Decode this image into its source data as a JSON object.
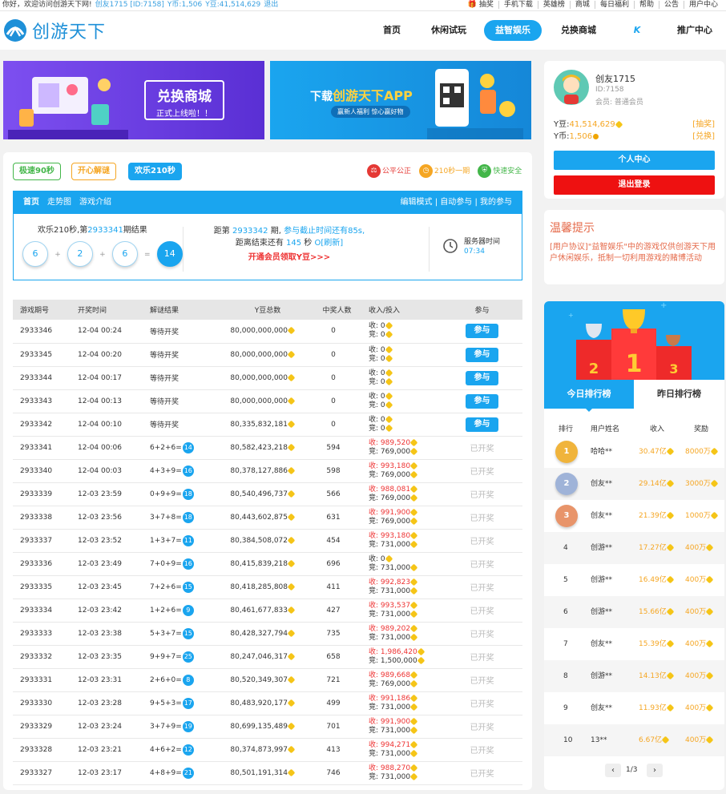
{
  "topbar": {
    "greeting": "你好，欢迎访问创游天下网!",
    "user": "创友1715 [ID:7158]",
    "ycoin": "Y币:1,506",
    "ybean": "Y豆:41,514,629",
    "logout": "退出",
    "links": [
      "抽奖",
      "手机下载",
      "英雄榜",
      "商城",
      "每日福利",
      "帮助",
      "公告",
      "用户中心"
    ]
  },
  "nav": {
    "logo": "创游天下",
    "items": [
      "首页",
      "休闲试玩",
      "益智娱乐",
      "兑换商城",
      "推广中心"
    ],
    "active_index": 2
  },
  "banners": {
    "shop_title": "兑换商城",
    "shop_sub": "正式上线啦！！",
    "app_prefix": "下载",
    "app_name": "创游天下APP",
    "app_sub": "赢新人福利 惊心赢好物"
  },
  "game_tabs": [
    "极速90秒",
    "开心解谜",
    "欢乐210秒"
  ],
  "badges": [
    {
      "icon": "⚖",
      "label": "公平公正",
      "color": "#e53935"
    },
    {
      "icon": "◷",
      "label": "210秒一期",
      "color": "#f5a623"
    },
    {
      "icon": "⛨",
      "label": "快速安全",
      "color": "#43b649"
    }
  ],
  "info": {
    "tabs": [
      "首页",
      "走势图",
      "游戏介绍"
    ],
    "links": [
      "编辑模式",
      "自动参与",
      "我的参与"
    ],
    "last_title": "欢乐210秒,第",
    "last_period": "2933341",
    "last_suffix": "期结果",
    "balls": [
      "6",
      "2",
      "6"
    ],
    "result": "14",
    "next_prefix": "距第",
    "next_period": "2933342",
    "next_mid": "期,",
    "next_deadline": "参与截止时间还有85s,",
    "end_prefix": "距离结束还有",
    "end_seconds": "145",
    "end_unit": "秒",
    "refresh": "O[刷新]",
    "vip": "开通会员领取Y豆>>>",
    "server_label": "服务器时间",
    "server_time": "07:34"
  },
  "table": {
    "headers": [
      "游戏期号",
      "开奖时间",
      "解谜结果",
      "Y豆总数",
      "中奖人数",
      "收入/投入",
      "参与"
    ],
    "rows": [
      {
        "id": "2933346",
        "time": "12-04 00:24",
        "formula": "",
        "result": "",
        "pending": "等待开奖",
        "total": "80,000,000,000",
        "winners": "0",
        "income": "收: 0",
        "stake": "竞: 0",
        "red": false,
        "open": true
      },
      {
        "id": "2933345",
        "time": "12-04 00:20",
        "formula": "",
        "result": "",
        "pending": "等待开奖",
        "total": "80,000,000,000",
        "winners": "0",
        "income": "收: 0",
        "stake": "竞: 0",
        "red": false,
        "open": true
      },
      {
        "id": "2933344",
        "time": "12-04 00:17",
        "formula": "",
        "result": "",
        "pending": "等待开奖",
        "total": "80,000,000,000",
        "winners": "0",
        "income": "收: 0",
        "stake": "竞: 0",
        "red": false,
        "open": true
      },
      {
        "id": "2933343",
        "time": "12-04 00:13",
        "formula": "",
        "result": "",
        "pending": "等待开奖",
        "total": "80,000,000,000",
        "winners": "0",
        "income": "收: 0",
        "stake": "竞: 0",
        "red": false,
        "open": true
      },
      {
        "id": "2933342",
        "time": "12-04 00:10",
        "formula": "",
        "result": "",
        "pending": "等待开奖",
        "total": "80,335,832,181",
        "winners": "0",
        "income": "收: 0",
        "stake": "竞: 0",
        "red": false,
        "open": true
      },
      {
        "id": "2933341",
        "time": "12-04 00:06",
        "formula": "6+2+6=",
        "result": "14",
        "pending": "",
        "total": "80,582,423,218",
        "winners": "594",
        "income": "收: 989,520",
        "stake": "竞: 769,000",
        "red": true,
        "open": false
      },
      {
        "id": "2933340",
        "time": "12-04 00:03",
        "formula": "4+3+9=",
        "result": "16",
        "pending": "",
        "total": "80,378,127,886",
        "winners": "598",
        "income": "收: 993,180",
        "stake": "竞: 769,000",
        "red": true,
        "open": false
      },
      {
        "id": "2933339",
        "time": "12-03 23:59",
        "formula": "0+9+9=",
        "result": "18",
        "pending": "",
        "total": "80,540,496,737",
        "winners": "566",
        "income": "收: 988,081",
        "stake": "竞: 769,000",
        "red": true,
        "open": false
      },
      {
        "id": "2933338",
        "time": "12-03 23:56",
        "formula": "3+7+8=",
        "result": "18",
        "pending": "",
        "total": "80,443,602,875",
        "winners": "631",
        "income": "收: 991,900",
        "stake": "竞: 769,000",
        "red": true,
        "open": false
      },
      {
        "id": "2933337",
        "time": "12-03 23:52",
        "formula": "1+3+7=",
        "result": "11",
        "pending": "",
        "total": "80,384,508,072",
        "winners": "454",
        "income": "收: 993,180",
        "stake": "竞: 731,000",
        "red": true,
        "open": false
      },
      {
        "id": "2933336",
        "time": "12-03 23:49",
        "formula": "7+0+9=",
        "result": "16",
        "pending": "",
        "total": "80,415,839,218",
        "winners": "696",
        "income": "收: 0",
        "stake": "竞: 731,000",
        "red": false,
        "open": false
      },
      {
        "id": "2933335",
        "time": "12-03 23:45",
        "formula": "7+2+6=",
        "result": "15",
        "pending": "",
        "total": "80,418,285,808",
        "winners": "411",
        "income": "收: 992,823",
        "stake": "竞: 731,000",
        "red": true,
        "open": false
      },
      {
        "id": "2933334",
        "time": "12-03 23:42",
        "formula": "1+2+6=",
        "result": "9",
        "pending": "",
        "total": "80,461,677,833",
        "winners": "427",
        "income": "收: 993,537",
        "stake": "竞: 731,000",
        "red": true,
        "open": false
      },
      {
        "id": "2933333",
        "time": "12-03 23:38",
        "formula": "5+3+7=",
        "result": "15",
        "pending": "",
        "total": "80,428,327,794",
        "winners": "735",
        "income": "收: 989,202",
        "stake": "竞: 731,000",
        "red": true,
        "open": false
      },
      {
        "id": "2933332",
        "time": "12-03 23:35",
        "formula": "9+9+7=",
        "result": "25",
        "pending": "",
        "total": "80,247,046,317",
        "winners": "658",
        "income": "收: 1,986,420",
        "stake": "竞: 1,500,000",
        "red": true,
        "open": false
      },
      {
        "id": "2933331",
        "time": "12-03 23:31",
        "formula": "2+6+0=",
        "result": "8",
        "pending": "",
        "total": "80,520,349,307",
        "winners": "721",
        "income": "收: 989,668",
        "stake": "竞: 769,000",
        "red": true,
        "open": false
      },
      {
        "id": "2933330",
        "time": "12-03 23:28",
        "formula": "9+5+3=",
        "result": "17",
        "pending": "",
        "total": "80,483,920,177",
        "winners": "499",
        "income": "收: 991,186",
        "stake": "竞: 731,000",
        "red": true,
        "open": false
      },
      {
        "id": "2933329",
        "time": "12-03 23:24",
        "formula": "3+7+9=",
        "result": "19",
        "pending": "",
        "total": "80,699,135,489",
        "winners": "701",
        "income": "收: 991,900",
        "stake": "竞: 731,000",
        "red": true,
        "open": false
      },
      {
        "id": "2933328",
        "time": "12-03 23:21",
        "formula": "4+6+2=",
        "result": "12",
        "pending": "",
        "total": "80,374,873,997",
        "winners": "413",
        "income": "收: 994,271",
        "stake": "竞: 731,000",
        "red": true,
        "open": false
      },
      {
        "id": "2933327",
        "time": "12-03 23:17",
        "formula": "4+8+9=",
        "result": "21",
        "pending": "",
        "total": "80,501,191,314",
        "winners": "746",
        "income": "收: 988,270",
        "stake": "竞: 731,000",
        "red": true,
        "open": false
      }
    ],
    "join_label": "参与",
    "opened_label": "已开奖"
  },
  "profile": {
    "name": "创友1715",
    "id": "ID:7158",
    "level_label": "会员:",
    "level": "普通会员",
    "ybean_label": "Y豆:",
    "ybean": "41,514,629",
    "ybean_action": "[抽奖]",
    "ycoin_label": "Y币:",
    "ycoin": "1,506",
    "ycoin_action": "[兑换]",
    "center_btn": "个人中心",
    "logout_btn": "退出登录"
  },
  "notice": {
    "title": "温馨提示",
    "text": "[用户协议]\"益智娱乐\"中的游戏仅供创游天下用户休闲娱乐，抵制一切利用游戏的赌博活动"
  },
  "ranking": {
    "tabs": [
      "今日排行榜",
      "昨日排行榜"
    ],
    "headers": [
      "排行",
      "用户姓名",
      "收入",
      "奖励"
    ],
    "rows": [
      {
        "rank": "1",
        "name": "哈哈**",
        "income": "30.47亿",
        "reward": "8000万",
        "medal": "#f0b43c"
      },
      {
        "rank": "2",
        "name": "创友**",
        "income": "29.14亿",
        "reward": "3000万",
        "medal": "#9fb3d8"
      },
      {
        "rank": "3",
        "name": "创友**",
        "income": "21.39亿",
        "reward": "1000万",
        "medal": "#e8946a"
      },
      {
        "rank": "4",
        "name": "创游**",
        "income": "17.27亿",
        "reward": "400万",
        "medal": ""
      },
      {
        "rank": "5",
        "name": "创游**",
        "income": "16.49亿",
        "reward": "400万",
        "medal": ""
      },
      {
        "rank": "6",
        "name": "创游**",
        "income": "15.66亿",
        "reward": "400万",
        "medal": ""
      },
      {
        "rank": "7",
        "name": "创友**",
        "income": "15.39亿",
        "reward": "400万",
        "medal": ""
      },
      {
        "rank": "8",
        "name": "创游**",
        "income": "14.13亿",
        "reward": "400万",
        "medal": ""
      },
      {
        "rank": "9",
        "name": "创友**",
        "income": "11.93亿",
        "reward": "400万",
        "medal": ""
      },
      {
        "rank": "10",
        "name": "13**",
        "income": "6.67亿",
        "reward": "400万",
        "medal": ""
      }
    ],
    "page": "1/3"
  }
}
